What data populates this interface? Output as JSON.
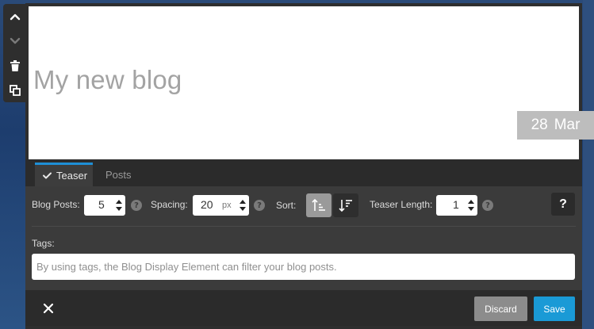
{
  "preview": {
    "title": "My new blog",
    "date_day": "28",
    "date_month": "Mar"
  },
  "tabs": [
    {
      "label": "Teaser",
      "active": true
    },
    {
      "label": "Posts",
      "active": false
    }
  ],
  "settings": {
    "blog_posts_label": "Blog Posts:",
    "blog_posts_value": "5",
    "spacing_label": "Spacing:",
    "spacing_value": "20",
    "spacing_unit": "px",
    "sort_label": "Sort:",
    "teaser_length_label": "Teaser Length:",
    "teaser_length_value": "1",
    "help_glyph": "?",
    "help_button_label": "?",
    "tags_label": "Tags:",
    "tags_placeholder": "By using tags, the Blog Display Element can filter your blog posts.",
    "tags_value": ""
  },
  "footer": {
    "discard_label": "Discard",
    "save_label": "Save"
  },
  "icons": {
    "toolbar": [
      "chevron-up-icon",
      "chevron-down-icon",
      "trash-icon",
      "duplicate-icon"
    ],
    "sort": [
      "sort-ascending-icon",
      "sort-descending-icon"
    ],
    "close": "close-icon",
    "tab_check": "check-icon"
  },
  "colors": {
    "accent": "#1a9ad6",
    "panel": "#3b3b3b",
    "frame": "#2e2e2e",
    "title_text": "#a3a3a3",
    "date_badge": "#bdbdbd",
    "discard": "#8c8c8c"
  }
}
